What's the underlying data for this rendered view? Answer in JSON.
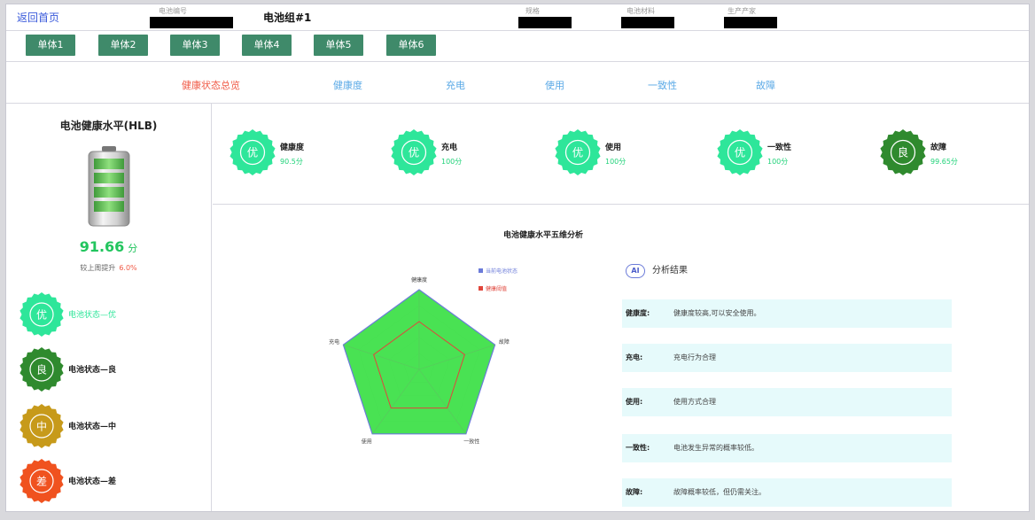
{
  "header": {
    "back_label": "返回首页",
    "battery_id_label": "电池编号",
    "group_name": "电池组#1",
    "spec_label": "规格",
    "material_label": "电池材料",
    "manufacturer_label": "生产产家"
  },
  "units": [
    "单体1",
    "单体2",
    "单体3",
    "单体4",
    "单体5",
    "单体6"
  ],
  "nav_tabs": {
    "items": [
      "健康状态总览",
      "健康度",
      "充电",
      "使用",
      "一致性",
      "故障"
    ],
    "active": "健康状态总览"
  },
  "left": {
    "title": "电池健康水平(HLB)",
    "score": "91.66",
    "score_unit": "分",
    "compare_label": "较上周提升",
    "compare_value": "6.0%",
    "legend": [
      {
        "grade": "优",
        "label": "电池状态—优",
        "color": "#2ee69a"
      },
      {
        "grade": "良",
        "label": "电池状态—良",
        "color": "#2f8a2e"
      },
      {
        "grade": "中",
        "label": "电池状态—中",
        "color": "#c79a1a"
      },
      {
        "grade": "差",
        "label": "电池状态—差",
        "color": "#f0521f"
      }
    ]
  },
  "cards": [
    {
      "grade": "优",
      "label": "健康度",
      "score": "90.5分",
      "color": "#2ee69a"
    },
    {
      "grade": "优",
      "label": "充电",
      "score": "100分",
      "color": "#2ee69a"
    },
    {
      "grade": "优",
      "label": "使用",
      "score": "100分",
      "color": "#2ee69a"
    },
    {
      "grade": "优",
      "label": "一致性",
      "score": "100分",
      "color": "#2ee69a"
    },
    {
      "grade": "良",
      "label": "故障",
      "score": "99.65分",
      "color": "#2f8a2e"
    }
  ],
  "chart_data": {
    "type": "radar",
    "title": "电池健康水平五维分析",
    "axes": [
      "健康度",
      "故障",
      "一致性",
      "使用",
      "充电"
    ],
    "max": 100,
    "series": [
      {
        "name": "当前电池状态",
        "values": [
          100,
          100,
          100,
          100,
          100
        ],
        "color": "#6b7bd9"
      },
      {
        "name": "健康阈值",
        "values": [
          60,
          60,
          60,
          60,
          60
        ],
        "color": "#e0463c"
      }
    ],
    "fill_color": "#3fe04a"
  },
  "analysis": {
    "heading": "分析结果",
    "ai_badge": "AI",
    "rows": [
      {
        "key": "健康度:",
        "value": "健康度较高,可以安全使用。"
      },
      {
        "key": "充电:",
        "value": "充电行为合理"
      },
      {
        "key": "使用:",
        "value": "使用方式合理"
      },
      {
        "key": "一致性:",
        "value": "电池发生异常的概率较低。"
      },
      {
        "key": "故障:",
        "value": "故障概率较低，但仍需关注。"
      }
    ]
  }
}
